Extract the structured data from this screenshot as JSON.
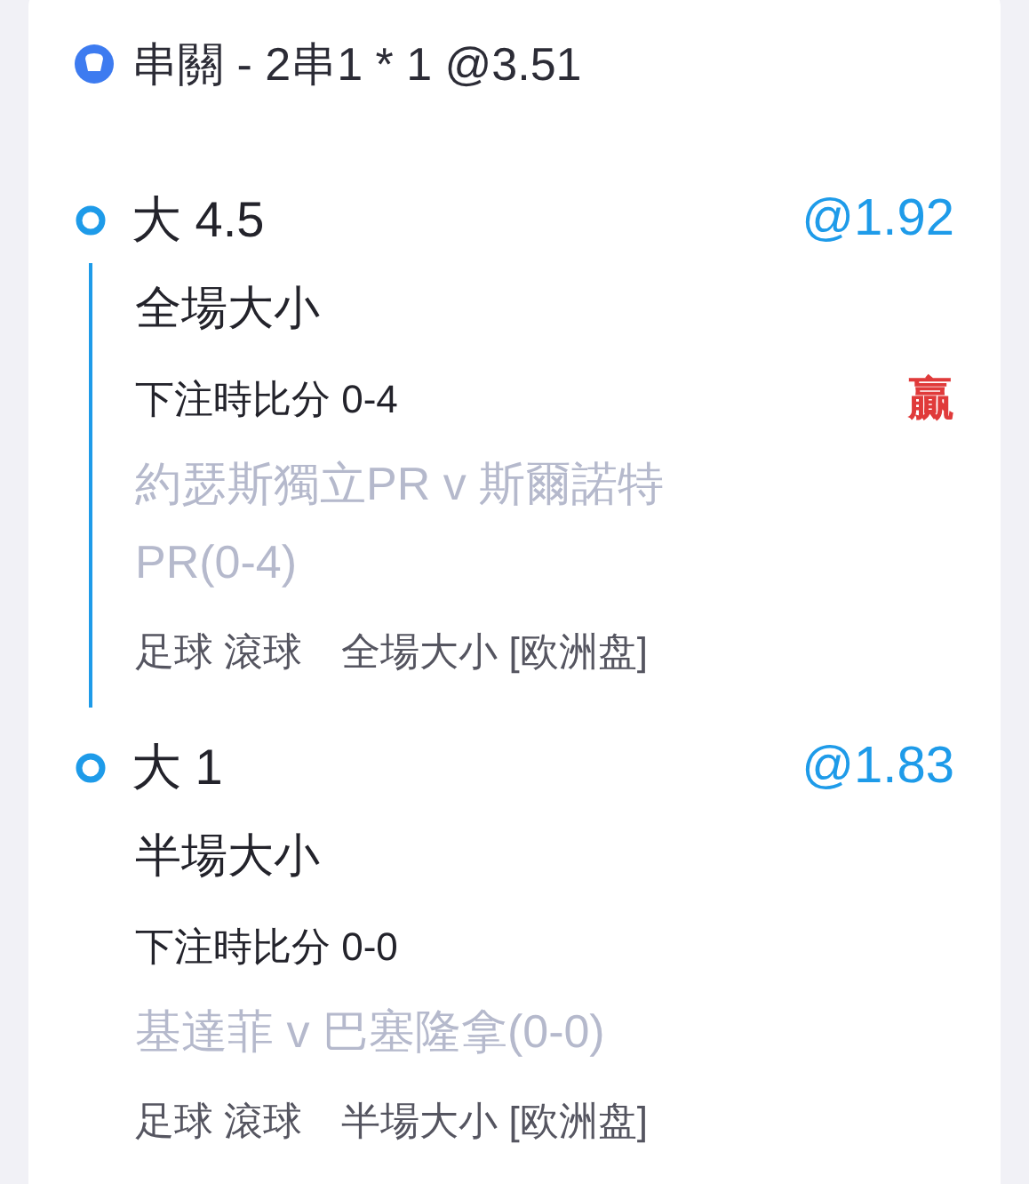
{
  "header": {
    "title": "串關 - 2串1 * 1 @3.51"
  },
  "legs": [
    {
      "selection": "大 4.5",
      "odds": "@1.92",
      "market": "全場大小",
      "score": "下注時比分 0-4",
      "result": "贏",
      "match": "約瑟斯獨立PR v 斯爾諾特PR(0-4)",
      "sport": "足球 滾球",
      "market_type": "全場大小 [欧洲盘]"
    },
    {
      "selection": "大 1",
      "odds": "@1.83",
      "market": "半場大小",
      "score": "下注時比分 0-0",
      "match": "基達菲 v 巴塞隆拿(0-0)",
      "sport": "足球 滾球",
      "market_type": "半場大小 [欧洲盘]"
    }
  ]
}
